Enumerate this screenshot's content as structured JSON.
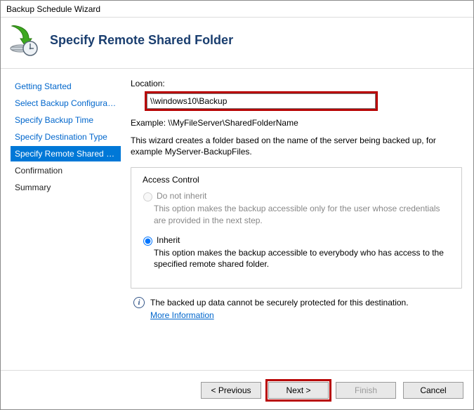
{
  "window": {
    "title": "Backup Schedule Wizard"
  },
  "header": {
    "title": "Specify Remote Shared Folder"
  },
  "sidebar": {
    "items": [
      {
        "label": "Getting Started"
      },
      {
        "label": "Select Backup Configurat..."
      },
      {
        "label": "Specify Backup Time"
      },
      {
        "label": "Specify Destination Type"
      },
      {
        "label": "Specify Remote Shared F..."
      },
      {
        "label": "Confirmation"
      },
      {
        "label": "Summary"
      }
    ]
  },
  "content": {
    "location_label": "Location:",
    "location_value": "\\\\windows10\\Backup",
    "example": "Example: \\\\MyFileServer\\SharedFolderName",
    "desc": "This wizard creates a folder based on the name of the server being backed up, for example MyServer-BackupFiles.",
    "access_control": {
      "legend": "Access Control",
      "do_not_inherit": {
        "label": "Do not inherit",
        "desc": "This option makes the backup accessible only for the user whose credentials are provided in the next step."
      },
      "inherit": {
        "label": "Inherit",
        "desc": "This option makes the backup accessible to everybody who has access to the specified remote shared folder."
      }
    },
    "info": {
      "text": "The backed up data cannot be securely protected for this destination.",
      "link": "More Information"
    }
  },
  "footer": {
    "previous": "< Previous",
    "next": "Next >",
    "finish": "Finish",
    "cancel": "Cancel"
  }
}
